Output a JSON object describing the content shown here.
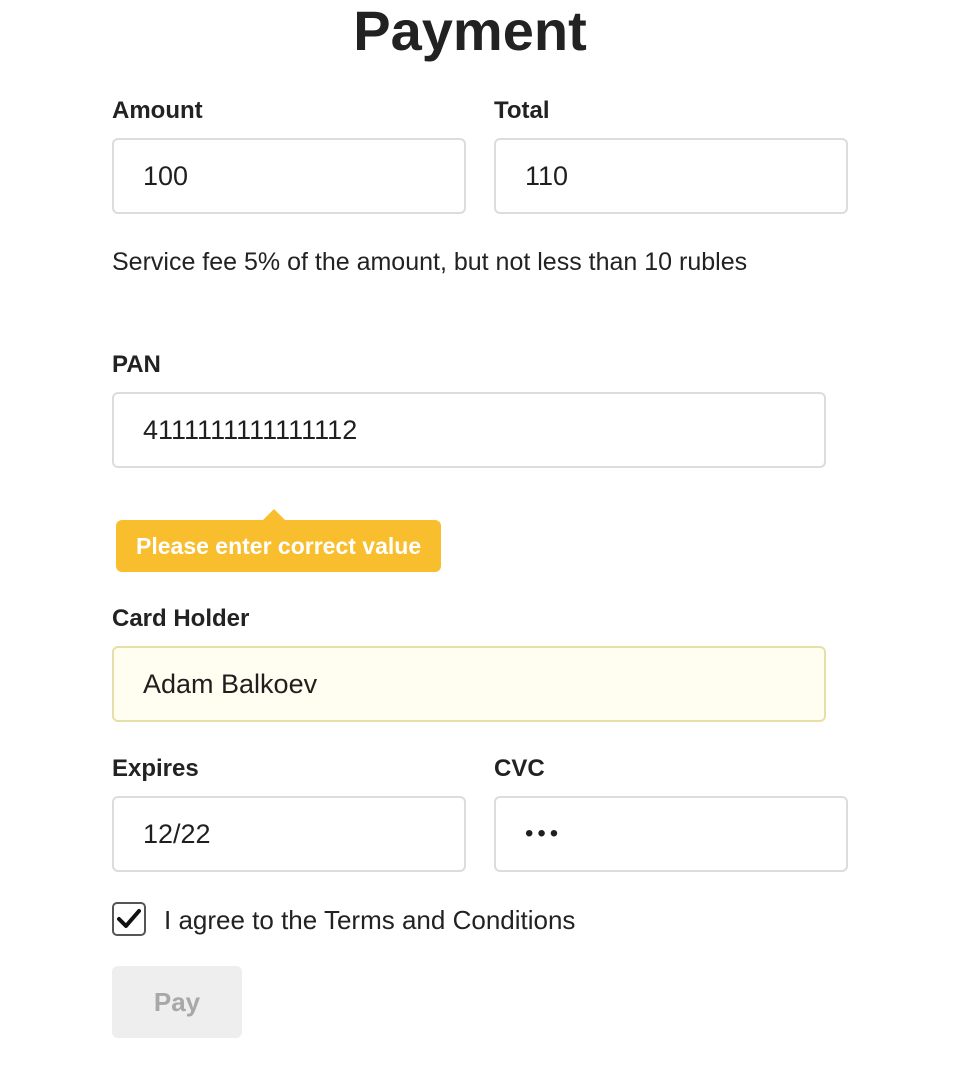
{
  "page": {
    "title": "Payment"
  },
  "form": {
    "amount": {
      "label": "Amount",
      "value": "100"
    },
    "total": {
      "label": "Total",
      "value": "110"
    },
    "fee_note": "Service fee 5% of the amount, but not less than 10 rubles",
    "pan": {
      "label": "PAN",
      "value": "4111111111111112",
      "error": "Please enter correct value"
    },
    "card_holder": {
      "label": "Card Holder",
      "value": "Adam Balkoev"
    },
    "expires": {
      "label": "Expires",
      "value": "12/22"
    },
    "cvc": {
      "label": "CVC",
      "value": "•••"
    },
    "terms": {
      "label": "I agree to the Terms and Conditions",
      "checked": true
    },
    "pay_button": {
      "label": "Pay",
      "disabled": true
    }
  },
  "colors": {
    "tooltip_bg": "#f9be2e",
    "autofill_bg": "#fffef0",
    "disabled_button_bg": "#eeeeee",
    "disabled_button_text": "#a8a8a8"
  }
}
